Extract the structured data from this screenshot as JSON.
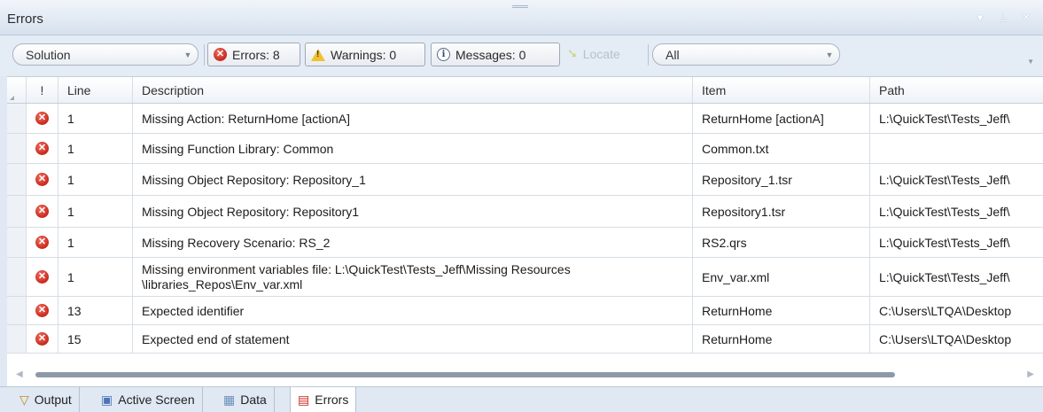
{
  "title": "Errors",
  "window_controls": [
    "dropdown-icon",
    "pin-icon",
    "close-icon"
  ],
  "toolbar": {
    "scope_value": "Solution",
    "errors_label": "Errors: 8",
    "warnings_label": "Warnings: 0",
    "messages_label": "Messages: 0",
    "locate_label": "Locate",
    "filter_value": "All"
  },
  "columns": [
    "!",
    "Line",
    "Description",
    "Item",
    "Path"
  ],
  "rows": [
    {
      "line": "1",
      "description": "Missing Action: ReturnHome [actionA]",
      "item": "ReturnHome [actionA]",
      "path": "L:\\QuickTest\\Tests_Jeff\\"
    },
    {
      "line": "1",
      "description": "Missing Function Library: Common",
      "item": "Common.txt",
      "path": ""
    },
    {
      "line": "1",
      "description": "Missing Object Repository: Repository_1",
      "item": "Repository_1.tsr",
      "path": "L:\\QuickTest\\Tests_Jeff\\"
    },
    {
      "line": "1",
      "description": "Missing Object Repository: Repository1",
      "item": "Repository1.tsr",
      "path": "L:\\QuickTest\\Tests_Jeff\\"
    },
    {
      "line": "1",
      "description": "Missing Recovery Scenario: RS_2",
      "item": "RS2.qrs",
      "path": "L:\\QuickTest\\Tests_Jeff\\"
    },
    {
      "line": "1",
      "description": "Missing environment variables file: L:\\QuickTest\\Tests_Jeff\\Missing Resources \\libraries_Repos\\Env_var.xml",
      "item": "Env_var.xml",
      "path": "L:\\QuickTest\\Tests_Jeff\\"
    },
    {
      "line": "13",
      "description": "Expected identifier",
      "item": "ReturnHome",
      "path": "C:\\Users\\LTQA\\Desktop"
    },
    {
      "line": "15",
      "description": "Expected end of statement",
      "item": "ReturnHome",
      "path": "C:\\Users\\LTQA\\Desktop"
    }
  ],
  "tabs": [
    {
      "label": "Output",
      "icon": "output-icon"
    },
    {
      "label": "Active Screen",
      "icon": "active-screen-icon"
    },
    {
      "label": "Data",
      "icon": "data-table-icon"
    },
    {
      "label": "Errors",
      "icon": "errors-icon"
    }
  ],
  "colors": {
    "error": "#c8281c",
    "header_bg": "#dfe8f3",
    "scroll_thumb": "#8e99a8"
  }
}
